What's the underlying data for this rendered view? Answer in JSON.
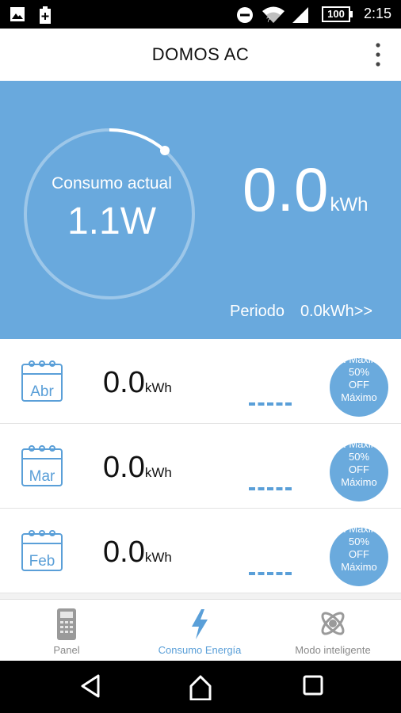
{
  "status_bar": {
    "icons": [
      "image-icon",
      "battery-charging-icon",
      "do-not-disturb-icon",
      "wifi-icon",
      "cell-signal-icon"
    ],
    "battery_level": "100",
    "time": "2:15"
  },
  "app_bar": {
    "title": "DOMOS AC",
    "menu_icon": "more-vert-icon"
  },
  "hero": {
    "current_label": "Consumo actual",
    "current_value": "1.1W",
    "total_value": "0.0",
    "total_unit": "kWh",
    "period_label": "Periodo",
    "period_value": "0.0kWh>>",
    "colors": {
      "background": "#69a9dd",
      "text": "#ffffff"
    }
  },
  "months": [
    {
      "month": "Abr",
      "value": "0.0",
      "unit": "kWh",
      "dash": "----",
      "badge_text": [
        "N Máxim",
        "50%",
        "OFF",
        "Máximo"
      ]
    },
    {
      "month": "Mar",
      "value": "0.0",
      "unit": "kWh",
      "dash": "----",
      "badge_text": [
        "N Máxim",
        "50%",
        "OFF",
        "Máximo"
      ]
    },
    {
      "month": "Feb",
      "value": "0.0",
      "unit": "kWh",
      "dash": "----",
      "badge_text": [
        "N Máxim",
        "50%",
        "OFF",
        "Máximo"
      ]
    }
  ],
  "bottom_nav": [
    {
      "label": "Panel",
      "icon": "remote-control-icon",
      "active": false
    },
    {
      "label": "Consumo Energía",
      "icon": "lightning-bolt-icon",
      "active": true
    },
    {
      "label": "Modo inteligente",
      "icon": "atom-icon",
      "active": false
    }
  ],
  "system_nav": [
    "back-icon",
    "home-icon",
    "recents-icon"
  ],
  "accent_color": "#5a9fd8"
}
